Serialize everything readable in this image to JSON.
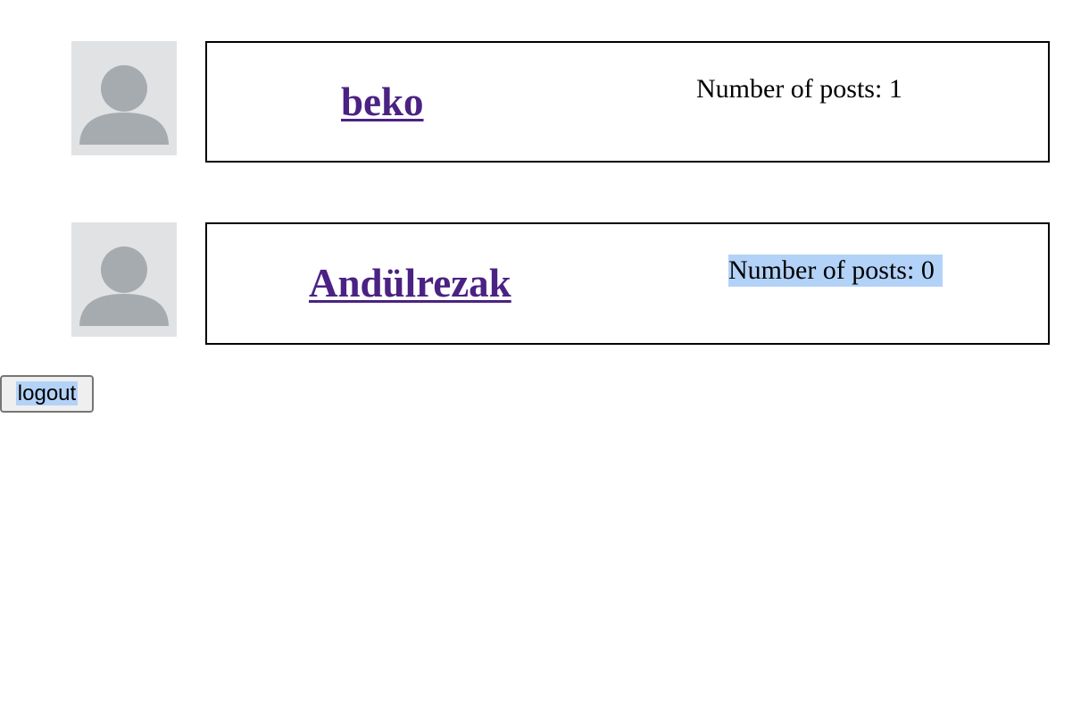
{
  "users": [
    {
      "name": "beko",
      "posts_label": "Number of posts: 1"
    },
    {
      "name": "Andülrezak",
      "posts_label": "Number of posts: 0"
    }
  ],
  "logout_label": "logout",
  "icons": {
    "avatar": "user-avatar-icon"
  },
  "colors": {
    "link": "#4b2283",
    "selection": "#b3d2f7",
    "avatar_bg": "#e1e2e3",
    "avatar_fg": "#a6abaf"
  }
}
